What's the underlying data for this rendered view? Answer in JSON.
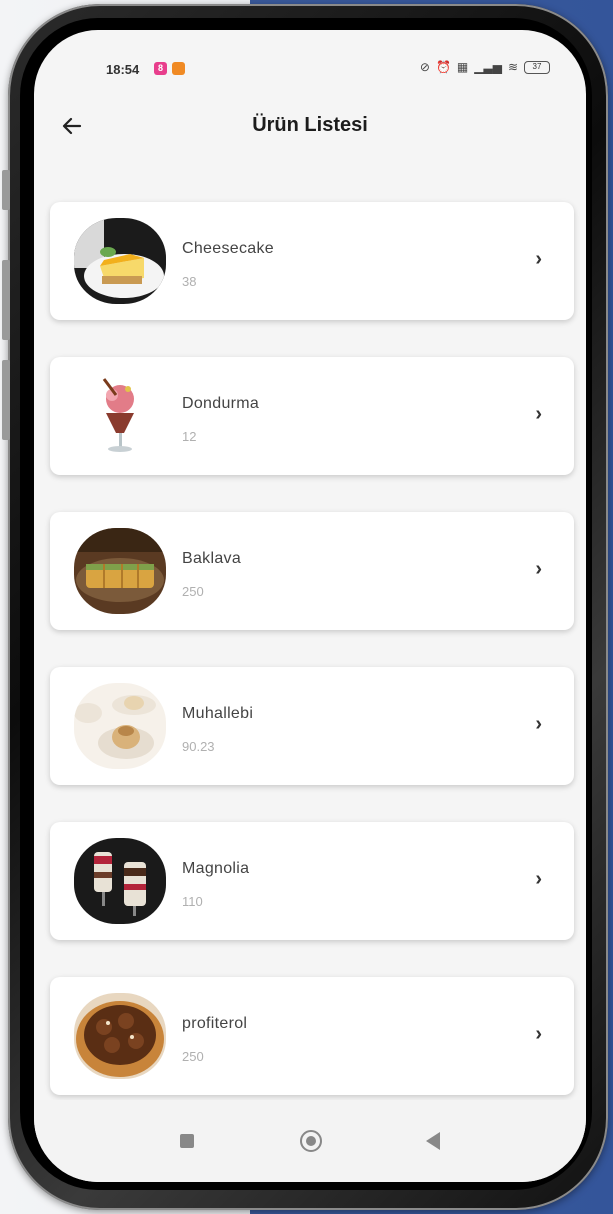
{
  "status_bar": {
    "time": "18:54",
    "badges": [
      {
        "icon": "notification-badge-pink",
        "color": "#e83e8c",
        "label": "8"
      },
      {
        "icon": "notification-badge-orange",
        "color": "#f08a24",
        "label": ""
      }
    ],
    "icons": [
      "nfc-icon",
      "alarm-icon",
      "data-icon",
      "signal-icon",
      "wifi-icon"
    ],
    "battery": "37"
  },
  "app_bar": {
    "back_icon": "arrow-left-icon",
    "title": "Ürün Listesi"
  },
  "products": [
    {
      "name": "Cheesecake",
      "price": "38",
      "image": "cheesecake-image"
    },
    {
      "name": "Dondurma",
      "price": "12",
      "image": "ice-cream-image"
    },
    {
      "name": "Baklava",
      "price": "250",
      "image": "baklava-image"
    },
    {
      "name": "Muhallebi",
      "price": "90.23",
      "image": "muhallebi-image"
    },
    {
      "name": "Magnolia",
      "price": "110",
      "image": "magnolia-image"
    },
    {
      "name": "profiterol",
      "price": "250",
      "image": "profiterol-image"
    }
  ],
  "nav_bar": {
    "buttons": [
      "recents-icon",
      "home-icon",
      "back-icon"
    ]
  },
  "colors": {
    "background_right": "#34559a",
    "card_background": "#ffffff",
    "price_text": "#b0b0b0"
  }
}
